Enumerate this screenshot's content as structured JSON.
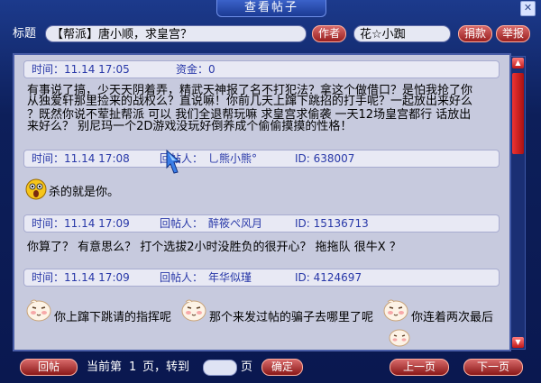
{
  "window": {
    "title": "查看帖子",
    "close_icon": "close-icon"
  },
  "topbar": {
    "title_label": "标题",
    "title_value": "【帮派】唐小顺，求皇宫？",
    "author_button": "作者",
    "author_value": "花☆小踟",
    "donate_button": "捐款",
    "report_button": "举报"
  },
  "post": {
    "time_label": "时间：11.14 17:05",
    "funds_label": "资金：0",
    "lines": [
      "有事说了搞，少天天阴着弄，精武天神报了名不打犯法？拿这个做借口？是怕我抢了你",
      "从独爱轩那里捡来的战权么？直说嘛！你前几天上蹿下跳招的打手呢？一起放出来好么",
      "？既然你说不荤扯帮派 可以 我们全退帮玩嘛 求皇宫求偷袭 一天12场皇宫都行 话放出",
      "来好么？ 别尼玛一个2D游戏没玩好倒养成个偷偷摸摸的性格！"
    ]
  },
  "replies": [
    {
      "time": "时间：11.14 17:08",
      "by_label": "回帖人：",
      "by": "乚熊小熊°",
      "id": "ID: 638007",
      "text": "杀的就是你。"
    },
    {
      "time": "时间：11.14 17:09",
      "by_label": "回帖人：",
      "by": "醉筱ぺ风月",
      "id": "ID: 15136713",
      "text": "你算了？ 有意思么？ 打个选拔2小时没胜负的很开心？ 拖拖队 很牛X ？"
    },
    {
      "time": "时间：11.14 17:09",
      "by_label": "回帖人：",
      "by": "年华似瑾",
      "id": "ID: 4124697",
      "text_parts": [
        "你上蹿下跳请的指挥呢",
        "那个来发过帖的骗子去哪里了呢",
        "你连着两次最后"
      ]
    }
  ],
  "footer": {
    "reply_button": "回帖",
    "current_prefix": "当前第",
    "current_page": "1",
    "page_suffix": "页，转到",
    "page_unit": "页",
    "confirm_button": "确定",
    "prev_button": "上一页",
    "next_button": "下一页"
  }
}
